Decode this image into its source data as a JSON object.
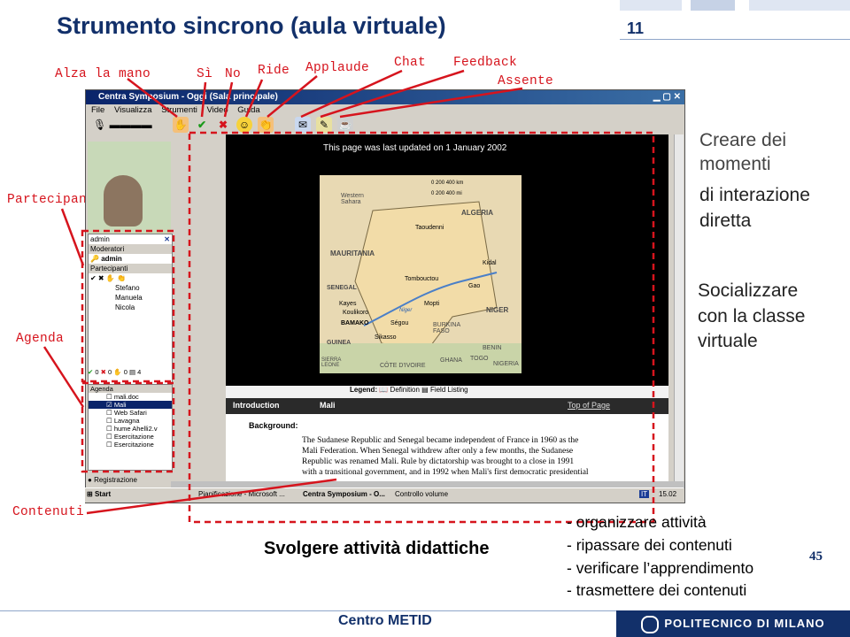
{
  "slide": {
    "title": "Strumento sincrono (aula virtuale)",
    "number": "11",
    "page_ref": "45"
  },
  "callouts": {
    "alza": "Alza la mano",
    "si": "Sì",
    "no": "No",
    "ride": "Ride",
    "applaude": "Applaude",
    "chat": "Chat",
    "feedback": "Feedback",
    "assente": "Assente",
    "partecipanti": "Partecipanti",
    "agenda": "Agenda",
    "contenuti": "Contenuti"
  },
  "window": {
    "title": "Centra Symposium - Oggi (Sala principale)",
    "menu": [
      "File",
      "Visualizza",
      "Strumenti",
      "Video",
      "Guida"
    ],
    "moderators_header": "Moderatori",
    "moderator_name": "admin",
    "participants_header": "Partecipanti",
    "participants": [
      "Stefano",
      "Manuela",
      "Nicola"
    ],
    "status_counts": [
      "0",
      "0",
      "0",
      "4"
    ],
    "agenda_header": "Agenda",
    "agenda_items": [
      "mali.doc",
      "Mali",
      "Web Safari",
      "Lavagna",
      "hume Ahelli2.v",
      "Esercitazione",
      "Esercitazione"
    ],
    "registration": "Registrazione",
    "updated": "This page was last updated on 1 January 2002",
    "map_labels": [
      "Western Sahara",
      "ALGERIA",
      "Taoudenni",
      "MAURITANIA",
      "Kidal",
      "Tombouctou",
      "Gao",
      "SENEGAL",
      "Kayes",
      "Koulikoro",
      "BAMAKO",
      "Ségou",
      "Mopti",
      "NIGER",
      "BURKINA FASO",
      "GUINEA",
      "Sikasso",
      "BENIN",
      "SIERRA LEONE",
      "CÔTE D'IVOIRE",
      "GHANA",
      "TOGO",
      "NIGERIA",
      "Niger"
    ],
    "map_scale": [
      "0",
      "200",
      "400 km",
      "0",
      "200",
      "400 mi"
    ],
    "legend_label": "Legend:",
    "legend_definition": "Definition",
    "legend_field": "Field Listing",
    "intro_label": "Introduction",
    "intro_country": "Mali",
    "top_of_page": "Top of Page",
    "background_label": "Background:",
    "background_text": [
      "The Sudanese Republic and Senegal became independent of France in 1960 as the",
      "Mali Federation. When Senegal withdrew after only a few months, the Sudanese",
      "Republic was renamed Mali. Rule by dictatorship was brought to a close in 1991",
      "with a transitional government, and in 1992 when Mali's first democratic presidential"
    ],
    "taskbar": {
      "start": "Start",
      "items": [
        "Pianificazione - Microsoft ...",
        "Centra Symposium - O...",
        "Controllo volume"
      ],
      "clock": "15.02",
      "lang": "IT"
    }
  },
  "right_text": {
    "line1a": "Creare dei",
    "line1b": "momenti",
    "line2a": "di interazione",
    "line2b": "diretta",
    "line3a": "Socializzare",
    "line3b": "con la classe",
    "line3c": "virtuale"
  },
  "bottom": {
    "svolgere": "Svolgere attività didattiche",
    "items": [
      "- organizzare attività",
      "- ripassare dei contenuti",
      "- verificare l’apprendimento",
      "- trasmettere dei contenuti"
    ],
    "centro": "Centro METID",
    "polimi": "POLITECNICO DI MILANO"
  },
  "colors": {
    "title": "#12306a",
    "callout": "#d6141d",
    "brand": "#12306a"
  }
}
